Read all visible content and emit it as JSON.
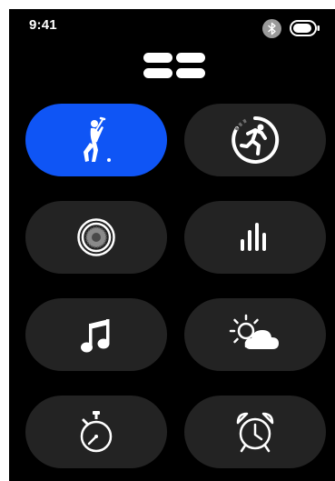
{
  "status_bar": {
    "time": "9:41",
    "icons": [
      "bluetooth-icon",
      "battery-icon"
    ]
  },
  "header": {
    "icon": "menu-icon"
  },
  "colors": {
    "background": "#000000",
    "tile": "#232323",
    "active_tile": "#0f55f5",
    "icon": "#ffffff"
  },
  "tiles": [
    {
      "icon": "golf-icon",
      "active": true
    },
    {
      "icon": "workout-run-icon",
      "active": false
    },
    {
      "icon": "speaker-icon",
      "active": false
    },
    {
      "icon": "stats-bars-icon",
      "active": false
    },
    {
      "icon": "music-note-icon",
      "active": false
    },
    {
      "icon": "weather-icon",
      "active": false
    },
    {
      "icon": "stopwatch-icon",
      "active": false
    },
    {
      "icon": "alarm-clock-icon",
      "active": false
    }
  ]
}
